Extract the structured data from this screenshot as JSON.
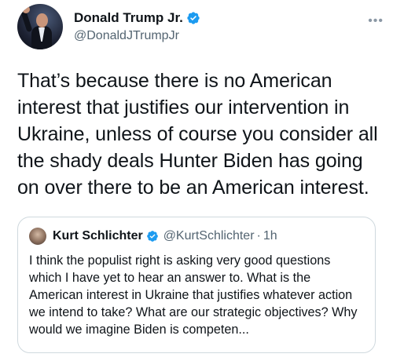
{
  "tweet": {
    "author": {
      "display_name": "Donald Trump Jr.",
      "handle": "@DonaldJTrumpJr",
      "verified": true
    },
    "more_icon": "more-horizontal-icon",
    "text": "That’s because there is no American interest that justifies our intervention in Ukraine, unless of course you consider all the shady deals Hunter Biden has going on over there to be an American interest."
  },
  "quote": {
    "author": {
      "display_name": "Kurt Schlichter",
      "handle": "@KurtSchlichter",
      "separator": "·",
      "time": "1h",
      "verified": true
    },
    "text": "I think the populist right is asking very good questions which I have yet to hear an answer to. What is the American interest in Ukraine that justifies whatever action we intend to take? What are our strategic objectives? Why would we imagine Biden is competen..."
  },
  "colors": {
    "text_primary": "#0f1419",
    "text_secondary": "#536471",
    "verified_blue": "#1d9bf0",
    "border": "#cfd9de"
  }
}
